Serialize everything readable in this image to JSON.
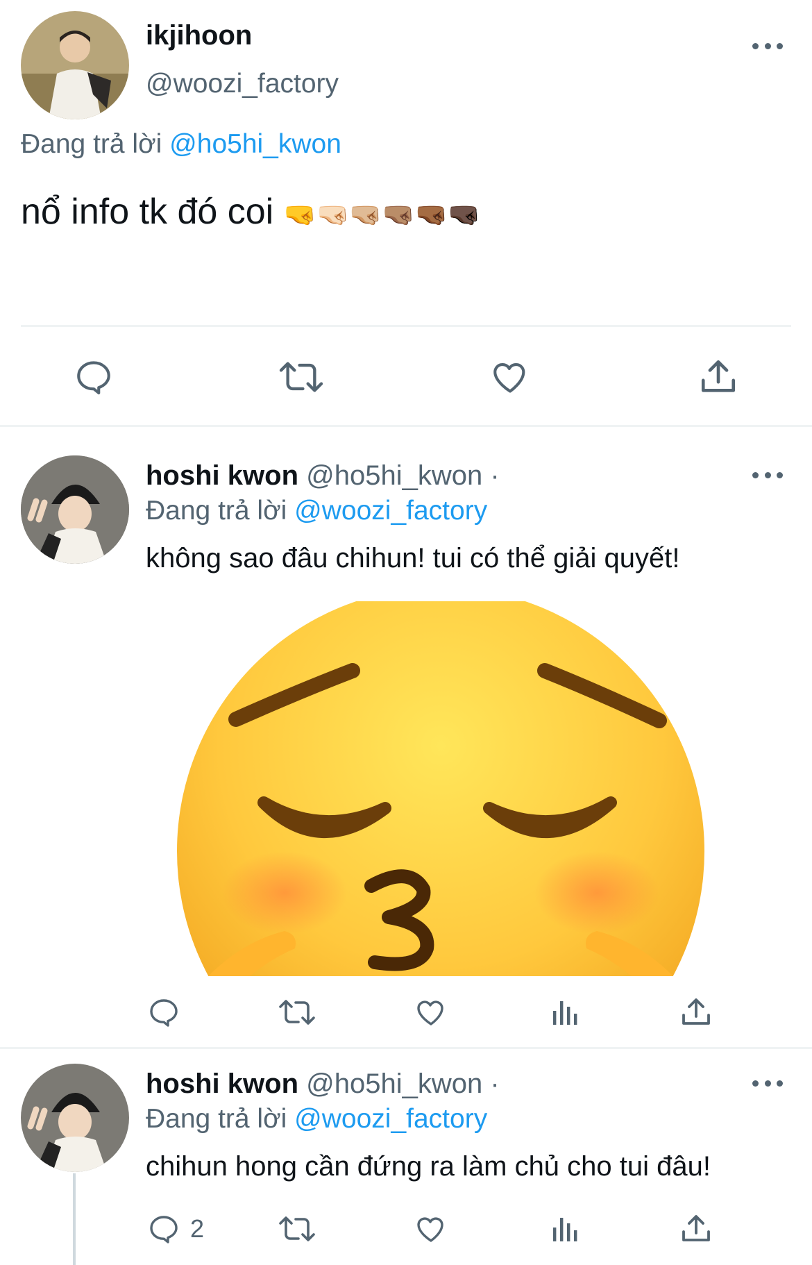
{
  "tweet_main": {
    "display_name": "ikjihoon",
    "handle": "@woozi_factory",
    "reply_prefix": "Đang trả lời",
    "reply_to": "@ho5hi_kwon",
    "text": "nổ info tk đó coi",
    "emoji": "🤜🤜🏻🤜🏼🤜🏽🤜🏾🤜🏿"
  },
  "reply1": {
    "display_name": "hoshi kwon",
    "handle": "@ho5hi_kwon ·",
    "reply_prefix": "Đang trả lời",
    "reply_to": "@woozi_factory",
    "text": "không sao đâu chihun! tui có thể giải quyết!",
    "image_label": "pleading kiss emoji"
  },
  "reply2": {
    "display_name": "hoshi kwon",
    "handle": "@ho5hi_kwon ·",
    "reply_prefix": "Đang trả lời",
    "reply_to": "@woozi_factory",
    "text": "chihun hong cần đứng ra làm chủ cho tui đâu!",
    "reply_count": "2"
  },
  "colors": {
    "text": "#0f1419",
    "secondary": "#536471",
    "link": "#1d9bf0",
    "divider": "#eff3f4",
    "emoji_yellow": "#ffc83d"
  }
}
